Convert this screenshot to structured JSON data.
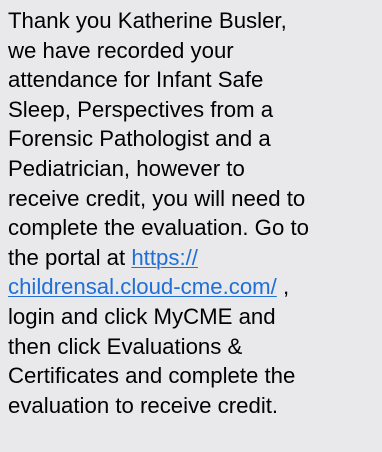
{
  "message": {
    "line_1": "Thank you  Katherine Busler,",
    "line_2": "we have recorded your",
    "line_3": "attendance for Infant Safe",
    "line_4": "Sleep, Perspectives from a",
    "line_5": "Forensic Pathologist and a",
    "line_6": "Pediatrician, however to",
    "line_7": "receive credit, you will need to",
    "line_8": "complete the evaluation. Go to",
    "line_9_text": "the portal at ",
    "link_part_1": "https://",
    "link_part_2": "childrensal.cloud-cme.com/",
    "line_10_suffix": " ,",
    "line_11": "login and click MyCME and",
    "line_12": "then click Evaluations &",
    "line_13": "Certificates and complete the",
    "line_14": "evaluation to receive credit."
  },
  "colors": {
    "bubble_background": "#e9e9ec",
    "text": "#000000",
    "link": "#1f6fd6"
  }
}
